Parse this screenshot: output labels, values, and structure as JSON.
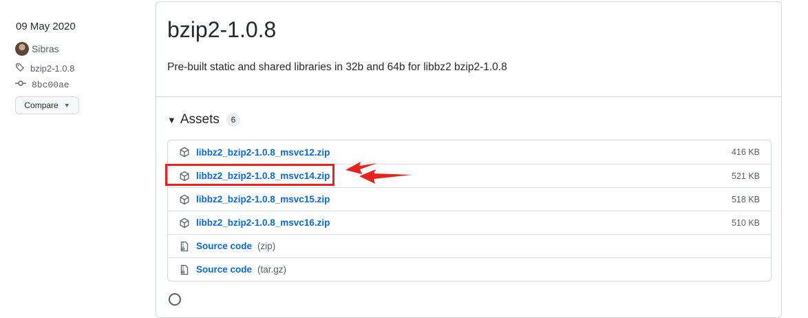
{
  "sidebar": {
    "date": "09 May 2020",
    "author": "Sibras",
    "tag": "bzip2-1.0.8",
    "commit": "8bc00ae",
    "compare_label": "Compare"
  },
  "release": {
    "title": "bzip2-1.0.8",
    "description": "Pre-built static and shared libraries in 32b and 64b for libbz2 bzip2-1.0.8"
  },
  "assets": {
    "label": "Assets",
    "count": "6",
    "items": [
      {
        "name": "libbz2_bzip2-1.0.8_msvc12.zip",
        "size": "416 KB",
        "icon": "package-icon"
      },
      {
        "name": "libbz2_bzip2-1.0.8_msvc14.zip",
        "size": "521 KB",
        "icon": "package-icon"
      },
      {
        "name": "libbz2_bzip2-1.0.8_msvc15.zip",
        "size": "518 KB",
        "icon": "package-icon"
      },
      {
        "name": "libbz2_bzip2-1.0.8_msvc16.zip",
        "size": "510 KB",
        "icon": "package-icon"
      },
      {
        "name": "Source code",
        "ext": "(zip)",
        "icon": "file-zip-icon"
      },
      {
        "name": "Source code",
        "ext": "(tar.gz)",
        "icon": "file-zip-icon"
      }
    ]
  },
  "annotation_color": "#e8221e"
}
